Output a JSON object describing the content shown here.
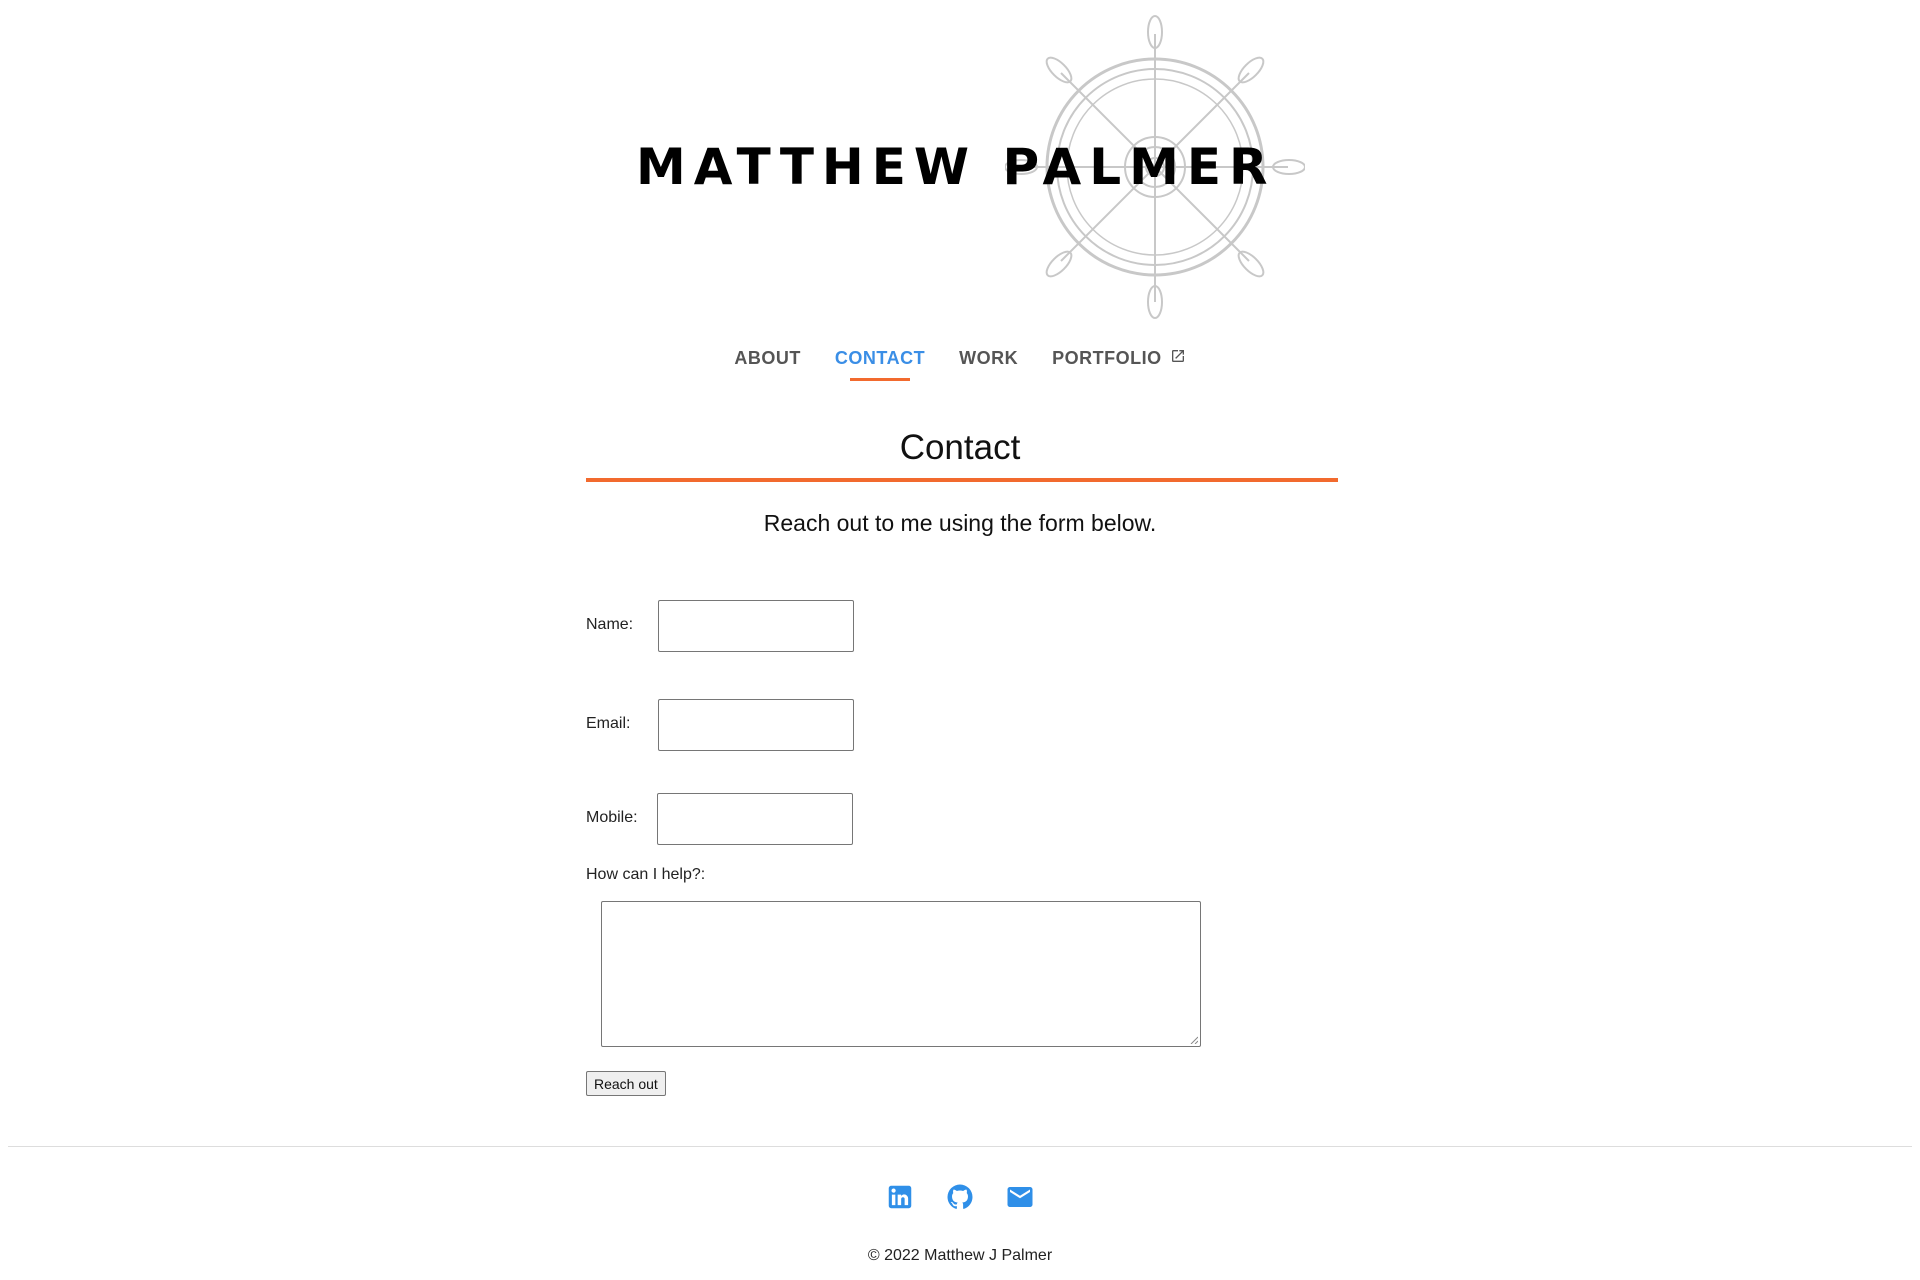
{
  "header": {
    "site_name": "MATTHEW PALMER",
    "logo_icon": "ships-wheel-icon"
  },
  "nav": {
    "items": [
      {
        "label": "ABOUT",
        "active": false
      },
      {
        "label": "CONTACT",
        "active": true
      },
      {
        "label": "WORK",
        "active": false
      },
      {
        "label": "PORTFOLIO",
        "active": false,
        "icon": "external-link-icon"
      }
    ]
  },
  "main": {
    "title": "Contact",
    "intro": "Reach out to me using the form below.",
    "form": {
      "name_label": "Name:",
      "name_value": "",
      "email_label": "Email:",
      "email_value": "",
      "mobile_label": "Mobile:",
      "mobile_value": "",
      "message_label": "How can I help?:",
      "message_value": "",
      "submit_label": "Reach out"
    }
  },
  "footer": {
    "social": [
      {
        "name": "linkedin-icon"
      },
      {
        "name": "github-icon"
      },
      {
        "name": "email-icon"
      }
    ],
    "copyright": "© 2022 Matthew J Palmer"
  },
  "colors": {
    "accent": "#f26a2e",
    "link_active": "#3a8ee6",
    "icon_blue": "#2f8fe8"
  }
}
